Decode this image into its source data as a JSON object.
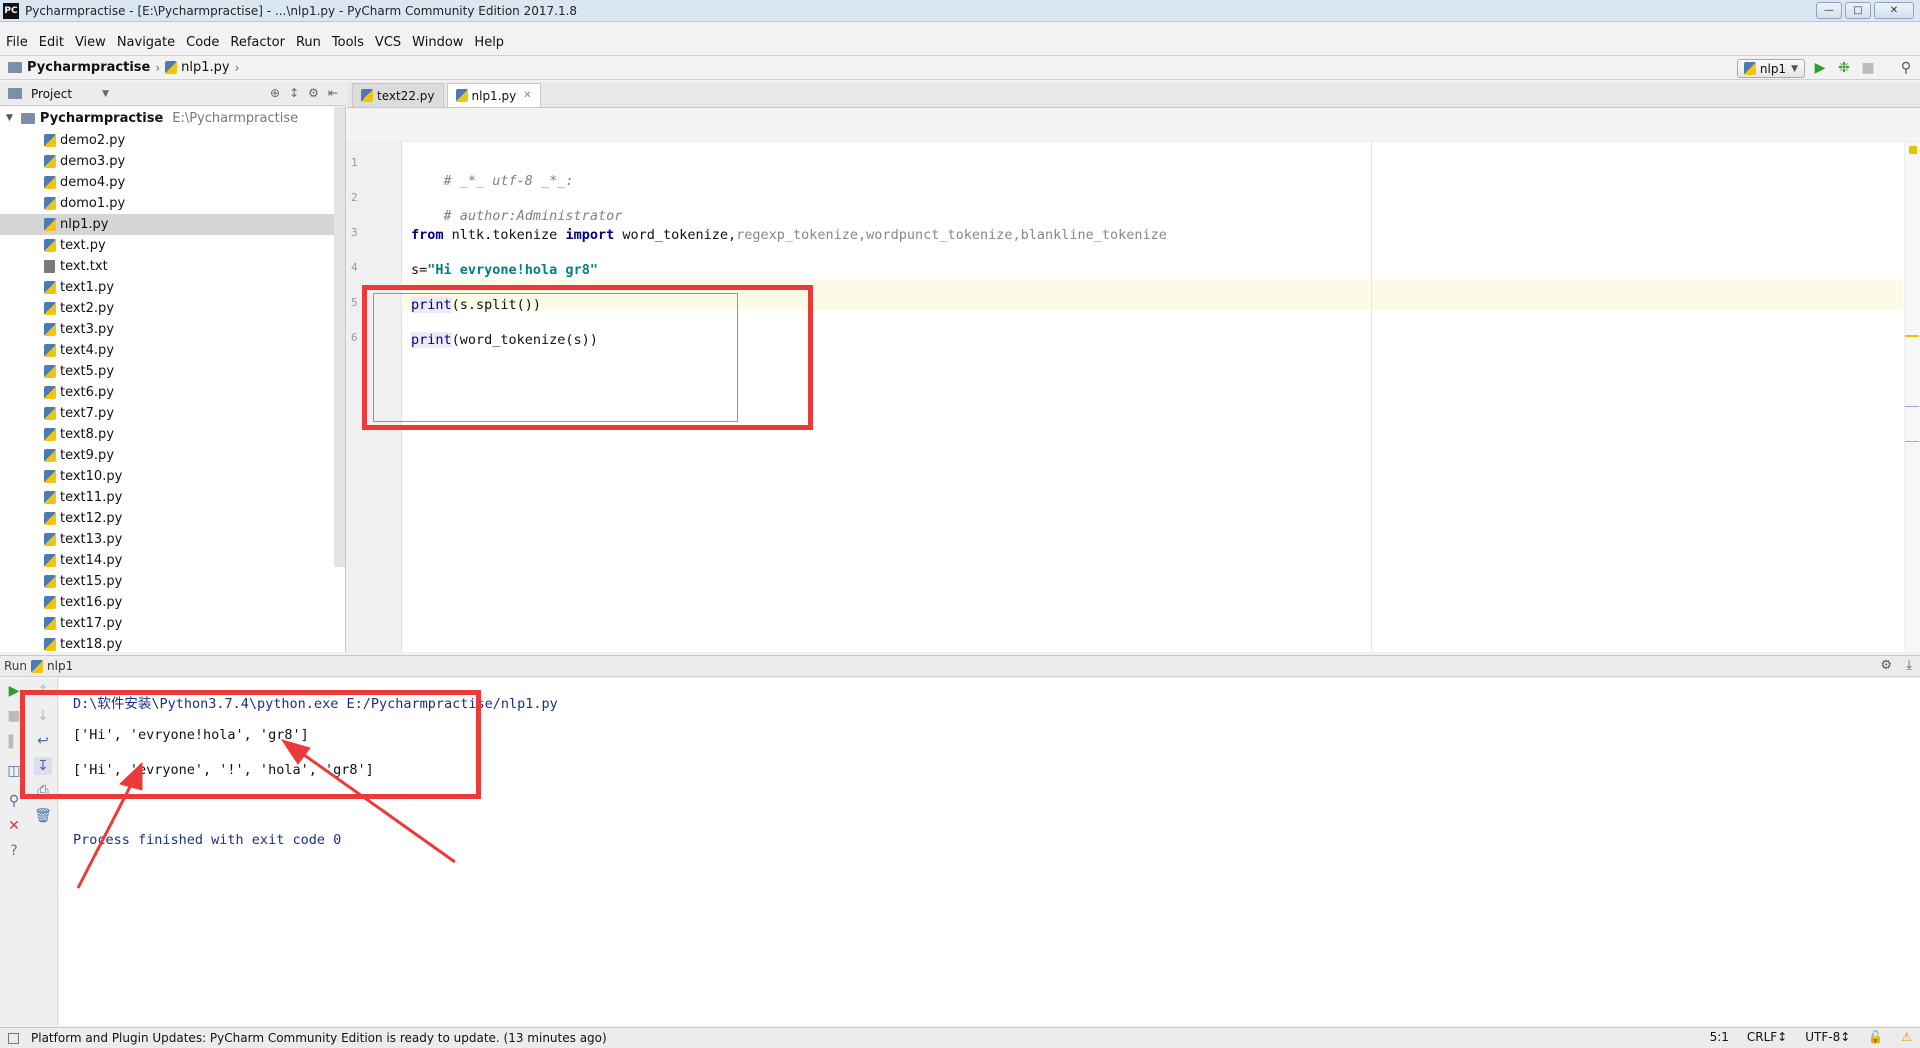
{
  "window": {
    "title": "Pycharmpractise - [E:\\Pycharmpractise] - ...\\nlp1.py - PyCharm Community Edition 2017.1.8",
    "app_icon": "PC"
  },
  "menu": [
    "File",
    "Edit",
    "View",
    "Navigate",
    "Code",
    "Refactor",
    "Run",
    "Tools",
    "VCS",
    "Window",
    "Help"
  ],
  "navbar": {
    "project": "Pycharmpractise",
    "file": "nlp1.py",
    "run_config": "nlp1"
  },
  "project_panel": {
    "title": "Project",
    "root_name": "Pycharmpractise",
    "root_path": "E:\\Pycharmpractise",
    "files": [
      {
        "name": "demo2.py",
        "type": "py"
      },
      {
        "name": "demo3.py",
        "type": "py"
      },
      {
        "name": "demo4.py",
        "type": "py"
      },
      {
        "name": "domo1.py",
        "type": "py"
      },
      {
        "name": "nlp1.py",
        "type": "py",
        "selected": true
      },
      {
        "name": "text.py",
        "type": "py"
      },
      {
        "name": "text.txt",
        "type": "txt"
      },
      {
        "name": "text1.py",
        "type": "py"
      },
      {
        "name": "text2.py",
        "type": "py"
      },
      {
        "name": "text3.py",
        "type": "py"
      },
      {
        "name": "text4.py",
        "type": "py"
      },
      {
        "name": "text5.py",
        "type": "py"
      },
      {
        "name": "text6.py",
        "type": "py"
      },
      {
        "name": "text7.py",
        "type": "py"
      },
      {
        "name": "text8.py",
        "type": "py"
      },
      {
        "name": "text9.py",
        "type": "py"
      },
      {
        "name": "text10.py",
        "type": "py"
      },
      {
        "name": "text11.py",
        "type": "py"
      },
      {
        "name": "text12.py",
        "type": "py"
      },
      {
        "name": "text13.py",
        "type": "py"
      },
      {
        "name": "text14.py",
        "type": "py"
      },
      {
        "name": "text15.py",
        "type": "py"
      },
      {
        "name": "text16.py",
        "type": "py"
      },
      {
        "name": "text17.py",
        "type": "py"
      },
      {
        "name": "text18.py",
        "type": "py"
      }
    ]
  },
  "tabs": [
    {
      "label": "text22.py",
      "active": false
    },
    {
      "label": "nlp1.py",
      "active": true
    }
  ],
  "code": {
    "line_numbers": [
      "1",
      "2",
      "3",
      "4",
      "5",
      "6"
    ],
    "line1": "# _*_ utf-8 _*_:",
    "line2": "# author:Administrator",
    "line3_from": "from",
    "line3_module": " nltk.tokenize ",
    "line3_import": "import",
    "line3_name": " word_tokenize,",
    "line3_rest": "regexp_tokenize,wordpunct_tokenize,blankline_tokenize",
    "line4_var": "s=",
    "line4_str": "\"Hi evryone!hola gr8\"",
    "line5_fn": "print",
    "line5_rest": "(s.split())",
    "line6_fn": "print",
    "line6_rest": "(word_tokenize(s))"
  },
  "run_panel": {
    "label": "Run",
    "config": "nlp1",
    "output": [
      "D:\\软件安装\\Python3.7.4\\python.exe E:/Pycharmpractise/nlp1.py",
      "['Hi', 'evryone!hola', 'gr8']",
      "['Hi', 'evryone', '!', 'hola', 'gr8']",
      "Process finished with exit code 0"
    ]
  },
  "statusbar": {
    "message": "Platform and Plugin Updates: PyCharm Community Edition is ready to update. (13 minutes ago)",
    "position": "5:1",
    "line_sep": "CRLF↕",
    "encoding": "UTF-8↕"
  },
  "colors": {
    "annotation_red": "#ea3a3a",
    "keyword": "#000080",
    "string": "#008080"
  }
}
